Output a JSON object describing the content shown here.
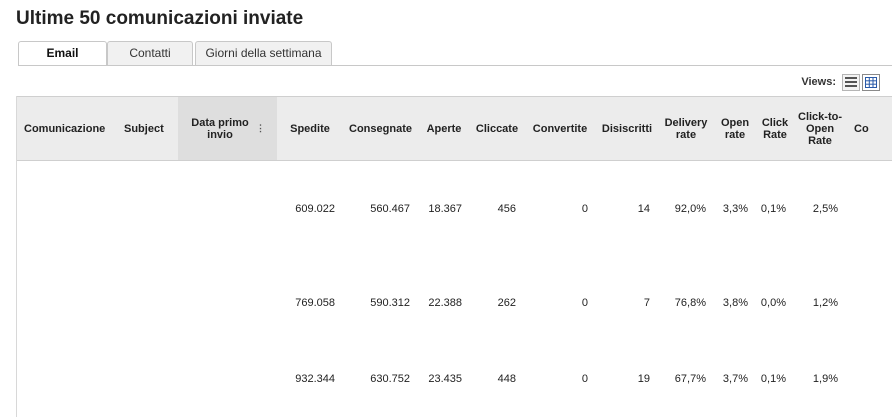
{
  "page": {
    "title": "Ultime 50 comunicazioni inviate"
  },
  "tabs": [
    {
      "label": "Email",
      "active": true
    },
    {
      "label": "Contatti",
      "active": false
    },
    {
      "label": "Giorni della settimana",
      "active": false
    }
  ],
  "views": {
    "label": "Views:",
    "options": [
      "list-view-icon",
      "grid-view-icon"
    ],
    "selected": "grid-view-icon"
  },
  "table": {
    "columns": [
      "Comunicazione",
      "Subject",
      "Data primo invio",
      "Spedite",
      "Consegnate",
      "Aperte",
      "Cliccate",
      "Convertite",
      "Disiscritti",
      "Delivery rate",
      "Open rate",
      "Click Rate",
      "Click-to-Open Rate",
      "Co"
    ],
    "sorted_column": "Data primo invio",
    "rows": [
      [
        "",
        "",
        "",
        "609.022",
        "560.467",
        "18.367",
        "456",
        "0",
        "14",
        "92,0%",
        "3,3%",
        "0,1%",
        "2,5%",
        ""
      ],
      [
        "",
        "",
        "",
        "769.058",
        "590.312",
        "22.388",
        "262",
        "0",
        "7",
        "76,8%",
        "3,8%",
        "0,0%",
        "1,2%",
        ""
      ],
      [
        "",
        "",
        "",
        "932.344",
        "630.752",
        "23.435",
        "448",
        "0",
        "19",
        "67,7%",
        "3,7%",
        "0,1%",
        "1,9%",
        ""
      ]
    ]
  },
  "colors": {
    "header_bg": "#ececec",
    "sorted_header_bg": "#dedede",
    "border": "#cfcfcf"
  }
}
